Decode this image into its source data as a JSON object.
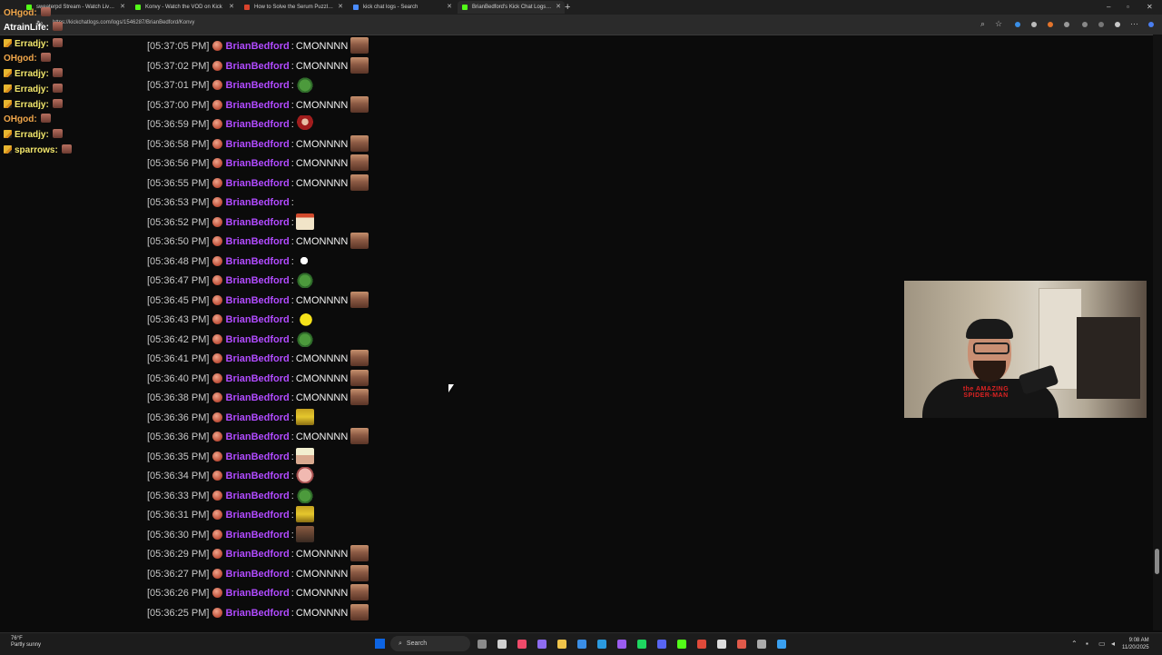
{
  "browser": {
    "tabs": [
      {
        "title": "sweaterpd Stream - Watch Live on Kick",
        "color": "#53fc18",
        "active": false
      },
      {
        "title": "Konvy - Watch the VOD on Kick",
        "color": "#53fc18",
        "active": false
      },
      {
        "title": "How to Solve the Serum Puzzle in ...",
        "color": "#d8432c",
        "active": false
      },
      {
        "title": "kick chat logs - Search",
        "color": "#4a8cff",
        "active": false
      },
      {
        "title": "BrianBedford's Kick Chat Logs in ...",
        "color": "#53fc18",
        "active": true
      }
    ],
    "url": "https://kickchatlogs.com/logs/1546287/BrianBedford/Konvy"
  },
  "overlay_chat": [
    {
      "name": "OHgod:",
      "color": "#f0a64a",
      "pencil": false
    },
    {
      "name": "AtrainLife:",
      "color": "#ffffff",
      "pencil": false
    },
    {
      "name": "Erradjy:",
      "color": "#f2e66b",
      "pencil": true
    },
    {
      "name": "OHgod:",
      "color": "#f0a64a",
      "pencil": false
    },
    {
      "name": "Erradjy:",
      "color": "#f2e66b",
      "pencil": true
    },
    {
      "name": "Erradjy:",
      "color": "#f2e66b",
      "pencil": true
    },
    {
      "name": "Erradjy:",
      "color": "#f2e66b",
      "pencil": true
    },
    {
      "name": "OHgod:",
      "color": "#f0a64a",
      "pencil": false
    },
    {
      "name": "Erradjy:",
      "color": "#f2e66b",
      "pencil": true
    },
    {
      "name": "sparrows:",
      "color": "#f2e66b",
      "pencil": true
    }
  ],
  "log": {
    "username": "BrianBedford",
    "separator": ":",
    "rows": [
      {
        "time": "[05:37:05 PM]",
        "text": "CMONNNN",
        "emote": "face"
      },
      {
        "time": "[05:37:02 PM]",
        "text": "CMONNNN",
        "emote": "face"
      },
      {
        "time": "[05:37:01 PM]",
        "text": "",
        "emote": "frog"
      },
      {
        "time": "[05:37:00 PM]",
        "text": "CMONNNN",
        "emote": "face"
      },
      {
        "time": "[05:36:59 PM]",
        "text": "",
        "emote": "red"
      },
      {
        "time": "[05:36:58 PM]",
        "text": "CMONNNN",
        "emote": "face"
      },
      {
        "time": "[05:36:56 PM]",
        "text": "CMONNNN",
        "emote": "face"
      },
      {
        "time": "[05:36:55 PM]",
        "text": "CMONNNN",
        "emote": "face"
      },
      {
        "time": "[05:36:53 PM]",
        "text": "",
        "emote": ""
      },
      {
        "time": "[05:36:52 PM]",
        "text": "",
        "emote": "box"
      },
      {
        "time": "[05:36:50 PM]",
        "text": "CMONNNN",
        "emote": "face"
      },
      {
        "time": "[05:36:48 PM]",
        "text": "",
        "emote": "mute"
      },
      {
        "time": "[05:36:47 PM]",
        "text": "",
        "emote": "frog"
      },
      {
        "time": "[05:36:45 PM]",
        "text": "CMONNNN",
        "emote": "face"
      },
      {
        "time": "[05:36:43 PM]",
        "text": "",
        "emote": "yellow"
      },
      {
        "time": "[05:36:42 PM]",
        "text": "",
        "emote": "frog"
      },
      {
        "time": "[05:36:41 PM]",
        "text": "CMONNNN",
        "emote": "face"
      },
      {
        "time": "[05:36:40 PM]",
        "text": "CMONNNN",
        "emote": "face"
      },
      {
        "time": "[05:36:38 PM]",
        "text": "CMONNNN",
        "emote": "face"
      },
      {
        "time": "[05:36:36 PM]",
        "text": "",
        "emote": "gold"
      },
      {
        "time": "[05:36:36 PM]",
        "text": "CMONNNN",
        "emote": "face"
      },
      {
        "time": "[05:36:35 PM]",
        "text": "",
        "emote": "blonde"
      },
      {
        "time": "[05:36:34 PM]",
        "text": "",
        "emote": "pink"
      },
      {
        "time": "[05:36:33 PM]",
        "text": "",
        "emote": "frog"
      },
      {
        "time": "[05:36:31 PM]",
        "text": "",
        "emote": "gold"
      },
      {
        "time": "[05:36:30 PM]",
        "text": "",
        "emote": "crow"
      },
      {
        "time": "[05:36:29 PM]",
        "text": "CMONNNN",
        "emote": "face"
      },
      {
        "time": "[05:36:27 PM]",
        "text": "CMONNNN",
        "emote": "face"
      },
      {
        "time": "[05:36:26 PM]",
        "text": "CMONNNN",
        "emote": "face"
      },
      {
        "time": "[05:36:25 PM]",
        "text": "CMONNNN",
        "emote": "face"
      }
    ]
  },
  "webcam": {
    "shirt_text": "the AMAZING SPIDER-MAN"
  },
  "taskbar": {
    "weather_temp": "76°F",
    "weather_desc": "Partly sunny",
    "search_label": "Search",
    "time": "9:08 AM",
    "date": "11/20/2025"
  }
}
